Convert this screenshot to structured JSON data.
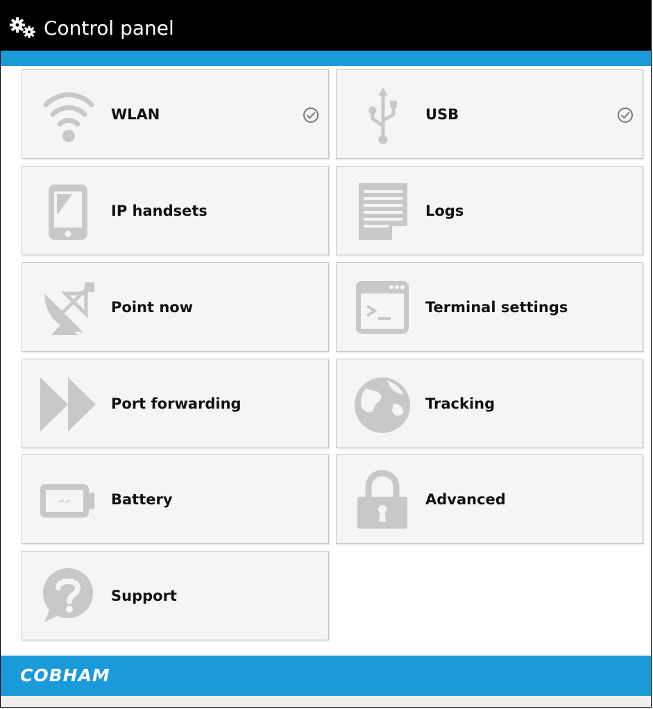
{
  "header": {
    "title": "Control panel"
  },
  "tiles": [
    {
      "label": "WLAN",
      "icon": "wifi-icon",
      "status": "check-circle-icon"
    },
    {
      "label": "USB",
      "icon": "usb-icon",
      "status": "check-circle-icon"
    },
    {
      "label": "IP handsets",
      "icon": "phone-handset-icon"
    },
    {
      "label": "Logs",
      "icon": "document-lines-icon"
    },
    {
      "label": "Point now",
      "icon": "satellite-dish-icon"
    },
    {
      "label": "Terminal settings",
      "icon": "terminal-window-icon"
    },
    {
      "label": "Port forwarding",
      "icon": "fast-forward-icon"
    },
    {
      "label": "Tracking",
      "icon": "globe-icon"
    },
    {
      "label": "Battery",
      "icon": "battery-icon"
    },
    {
      "label": "Advanced",
      "icon": "padlock-icon"
    },
    {
      "label": "Support",
      "icon": "question-bubble-icon"
    }
  ],
  "footer": {
    "brand": "COBHAM"
  },
  "colors": {
    "accent": "#1a9ad9",
    "tile_bg": "#f5f5f5",
    "icon_gray": "#c8c8c8",
    "title_bar": "#000000"
  }
}
